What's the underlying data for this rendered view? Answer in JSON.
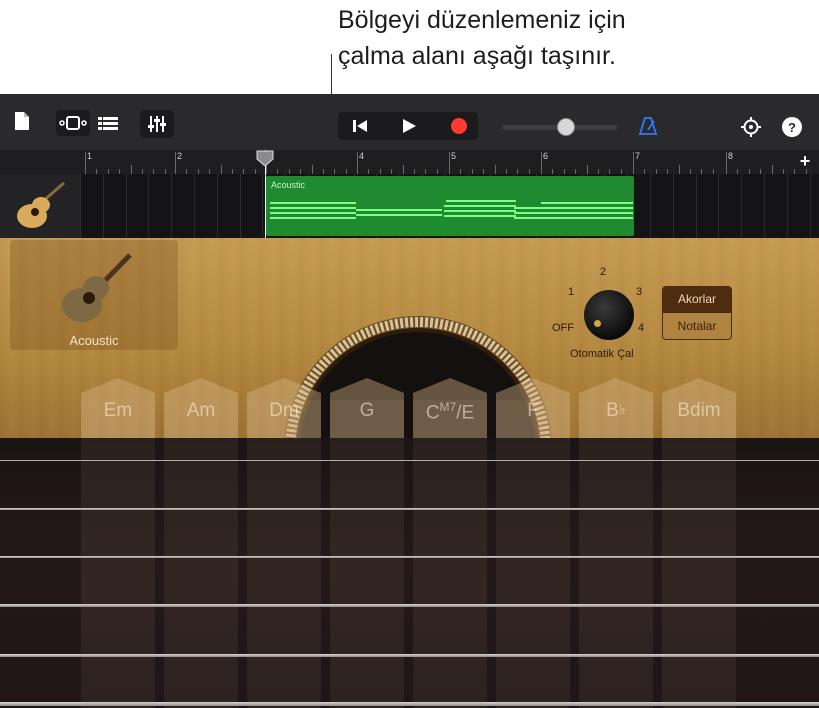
{
  "callout": {
    "line1": "Bölgeyi düzenlemeniz için",
    "line2": "çalma alanı aşağı taşınır."
  },
  "toolbar": {
    "icons": [
      "document-icon",
      "track-view-icon",
      "track-list-icon",
      "mixer-icon",
      "rewind-icon",
      "play-icon",
      "record-icon",
      "metronome-icon",
      "settings-icon",
      "help-icon"
    ],
    "help_label": "?",
    "master_volume": 0.55,
    "accent_color": "#2f7cf6",
    "record_color": "#ff3b30"
  },
  "ruler": {
    "bars": [
      "1",
      "2",
      "3",
      "4",
      "5",
      "6",
      "7",
      "8"
    ],
    "add_label": "+"
  },
  "track": {
    "region_name": "Acoustic",
    "region_color": "#1f8a2f"
  },
  "instrument": {
    "name": "Acoustic"
  },
  "autoplay": {
    "label": "Otomatik Çal",
    "positions": [
      "OFF",
      "1",
      "2",
      "3",
      "4"
    ],
    "selected": "OFF"
  },
  "mode_toggle": {
    "chords": "Akorlar",
    "notes": "Notalar",
    "selected": "Akorlar"
  },
  "chords": [
    "Em",
    "Am",
    "Dm",
    "G",
    "C",
    "F",
    "B",
    "Bdim"
  ],
  "chord_extras": {
    "c_sup": "M7",
    "c_tail": "/E",
    "b_flat": "♭"
  }
}
